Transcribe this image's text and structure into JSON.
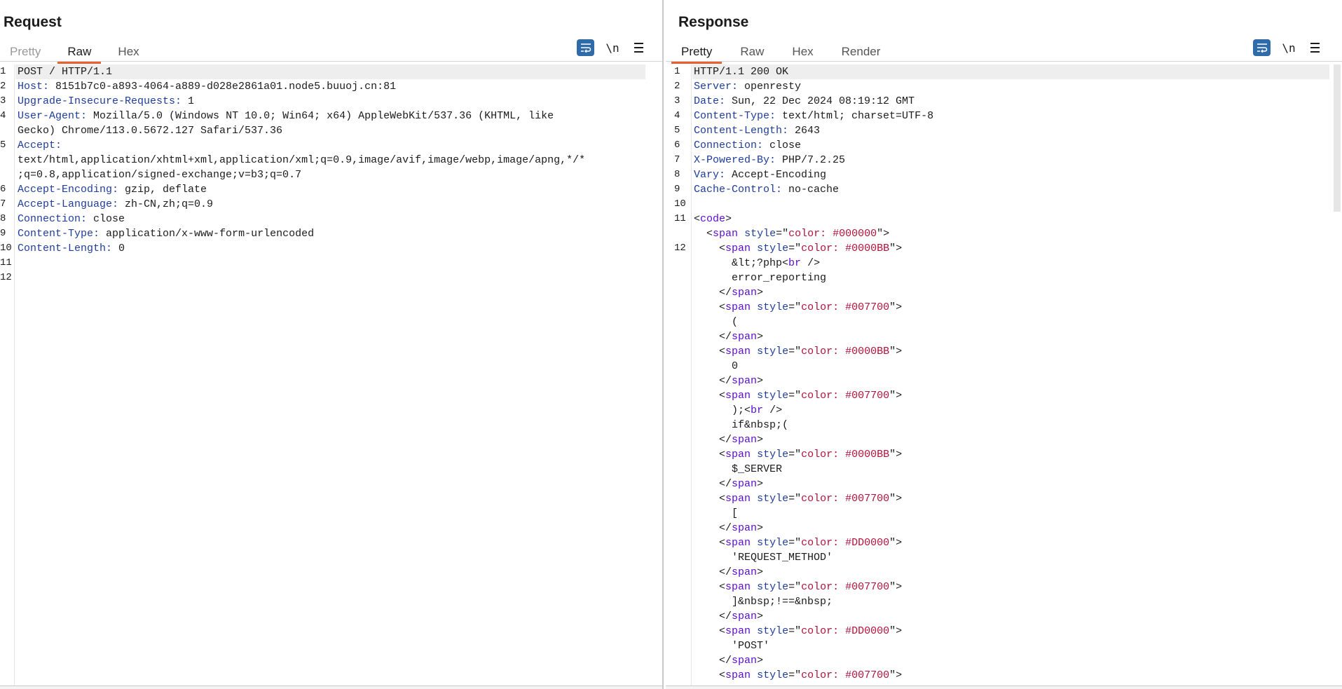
{
  "request": {
    "title": "Request",
    "tabs": [
      {
        "label": "Pretty",
        "state": "inactive-light"
      },
      {
        "label": "Raw",
        "state": "active"
      },
      {
        "label": "Hex",
        "state": "inactive"
      }
    ],
    "toolbar": {
      "newline_label": "\\n"
    },
    "lines": [
      {
        "n": "1",
        "key": "",
        "value": "POST / HTTP/1.1"
      },
      {
        "n": "2",
        "key": "Host:",
        "value": " 8151b7c0-a893-4064-a889-d028e2861a01.node5.buuoj.cn:81"
      },
      {
        "n": "3",
        "key": "Upgrade-Insecure-Requests:",
        "value": " 1"
      },
      {
        "n": "4",
        "key": "User-Agent:",
        "value": " Mozilla/5.0 (Windows NT 10.0; Win64; x64) AppleWebKit/537.36 (KHTML, like"
      },
      {
        "n": "",
        "key": "",
        "value": "Gecko) Chrome/113.0.5672.127 Safari/537.36"
      },
      {
        "n": "5",
        "key": "Accept:",
        "value": ""
      },
      {
        "n": "",
        "key": "",
        "value": "text/html,application/xhtml+xml,application/xml;q=0.9,image/avif,image/webp,image/apng,*/*"
      },
      {
        "n": "",
        "key": "",
        "value": ";q=0.8,application/signed-exchange;v=b3;q=0.7"
      },
      {
        "n": "6",
        "key": "Accept-Encoding:",
        "value": " gzip, deflate"
      },
      {
        "n": "7",
        "key": "Accept-Language:",
        "value": " zh-CN,zh;q=0.9"
      },
      {
        "n": "8",
        "key": "Connection:",
        "value": " close"
      },
      {
        "n": "9",
        "key": "Content-Type:",
        "value": " application/x-www-form-urlencoded"
      },
      {
        "n": "10",
        "key": "Content-Length:",
        "value": " 0"
      },
      {
        "n": "11",
        "key": "",
        "value": ""
      },
      {
        "n": "12",
        "key": "",
        "value": ""
      }
    ]
  },
  "response": {
    "title": "Response",
    "tabs": [
      {
        "label": "Pretty",
        "state": "active"
      },
      {
        "label": "Raw",
        "state": "inactive"
      },
      {
        "label": "Hex",
        "state": "inactive"
      },
      {
        "label": "Render",
        "state": "inactive"
      }
    ],
    "toolbar": {
      "newline_label": "\\n"
    },
    "header_lines": [
      {
        "n": "1",
        "key": "",
        "value": "HTTP/1.1 200 OK"
      },
      {
        "n": "2",
        "key": "Server:",
        "value": " openresty"
      },
      {
        "n": "3",
        "key": "Date:",
        "value": " Sun, 22 Dec 2024 08:19:12 GMT"
      },
      {
        "n": "4",
        "key": "Content-Type:",
        "value": " text/html; charset=UTF-8"
      },
      {
        "n": "5",
        "key": "Content-Length:",
        "value": " 2643"
      },
      {
        "n": "6",
        "key": "Connection:",
        "value": " close"
      },
      {
        "n": "7",
        "key": "X-Powered-By:",
        "value": " PHP/7.2.25"
      },
      {
        "n": "8",
        "key": "Vary:",
        "value": " Accept-Encoding"
      },
      {
        "n": "9",
        "key": "Cache-Control:",
        "value": " no-cache"
      },
      {
        "n": "10",
        "key": "",
        "value": ""
      }
    ],
    "body_lines": [
      {
        "n": "11",
        "indent": 0,
        "kind": "open",
        "tag": "code"
      },
      {
        "n": "",
        "indent": 1,
        "kind": "span",
        "color": "#000000"
      },
      {
        "n": "12",
        "indent": 2,
        "kind": "span",
        "color": "#0000BB"
      },
      {
        "n": "",
        "indent": 3,
        "kind": "text-br",
        "before": "&lt;?php",
        "after": ""
      },
      {
        "n": "",
        "indent": 3,
        "kind": "text",
        "text": "error_reporting"
      },
      {
        "n": "",
        "indent": 2,
        "kind": "close"
      },
      {
        "n": "",
        "indent": 2,
        "kind": "span",
        "color": "#007700"
      },
      {
        "n": "",
        "indent": 3,
        "kind": "text",
        "text": "("
      },
      {
        "n": "",
        "indent": 2,
        "kind": "close"
      },
      {
        "n": "",
        "indent": 2,
        "kind": "span",
        "color": "#0000BB"
      },
      {
        "n": "",
        "indent": 3,
        "kind": "text",
        "text": "0"
      },
      {
        "n": "",
        "indent": 2,
        "kind": "close"
      },
      {
        "n": "",
        "indent": 2,
        "kind": "span",
        "color": "#007700"
      },
      {
        "n": "",
        "indent": 3,
        "kind": "text-br",
        "before": ");",
        "after": ""
      },
      {
        "n": "",
        "indent": 3,
        "kind": "text",
        "text": "if&nbsp;("
      },
      {
        "n": "",
        "indent": 2,
        "kind": "close"
      },
      {
        "n": "",
        "indent": 2,
        "kind": "span",
        "color": "#0000BB"
      },
      {
        "n": "",
        "indent": 3,
        "kind": "text",
        "text": "$_SERVER"
      },
      {
        "n": "",
        "indent": 2,
        "kind": "close"
      },
      {
        "n": "",
        "indent": 2,
        "kind": "span",
        "color": "#007700"
      },
      {
        "n": "",
        "indent": 3,
        "kind": "text",
        "text": "["
      },
      {
        "n": "",
        "indent": 2,
        "kind": "close"
      },
      {
        "n": "",
        "indent": 2,
        "kind": "span",
        "color": "#DD0000"
      },
      {
        "n": "",
        "indent": 3,
        "kind": "text",
        "text": "'REQUEST_METHOD'"
      },
      {
        "n": "",
        "indent": 2,
        "kind": "close"
      },
      {
        "n": "",
        "indent": 2,
        "kind": "span",
        "color": "#007700"
      },
      {
        "n": "",
        "indent": 3,
        "kind": "text",
        "text": "]&nbsp;!==&nbsp;"
      },
      {
        "n": "",
        "indent": 2,
        "kind": "close"
      },
      {
        "n": "",
        "indent": 2,
        "kind": "span",
        "color": "#DD0000"
      },
      {
        "n": "",
        "indent": 3,
        "kind": "text",
        "text": "'POST'"
      },
      {
        "n": "",
        "indent": 2,
        "kind": "close"
      },
      {
        "n": "",
        "indent": 2,
        "kind": "span",
        "color": "#007700"
      }
    ],
    "syntax": {
      "span_tag": "span",
      "close_tag": "span",
      "style_attr": "style",
      "color_prefix": "color: ",
      "br_tag": "br"
    }
  },
  "theme": {
    "accent": "#e8602d",
    "button_blue": "#2f6aa9"
  }
}
